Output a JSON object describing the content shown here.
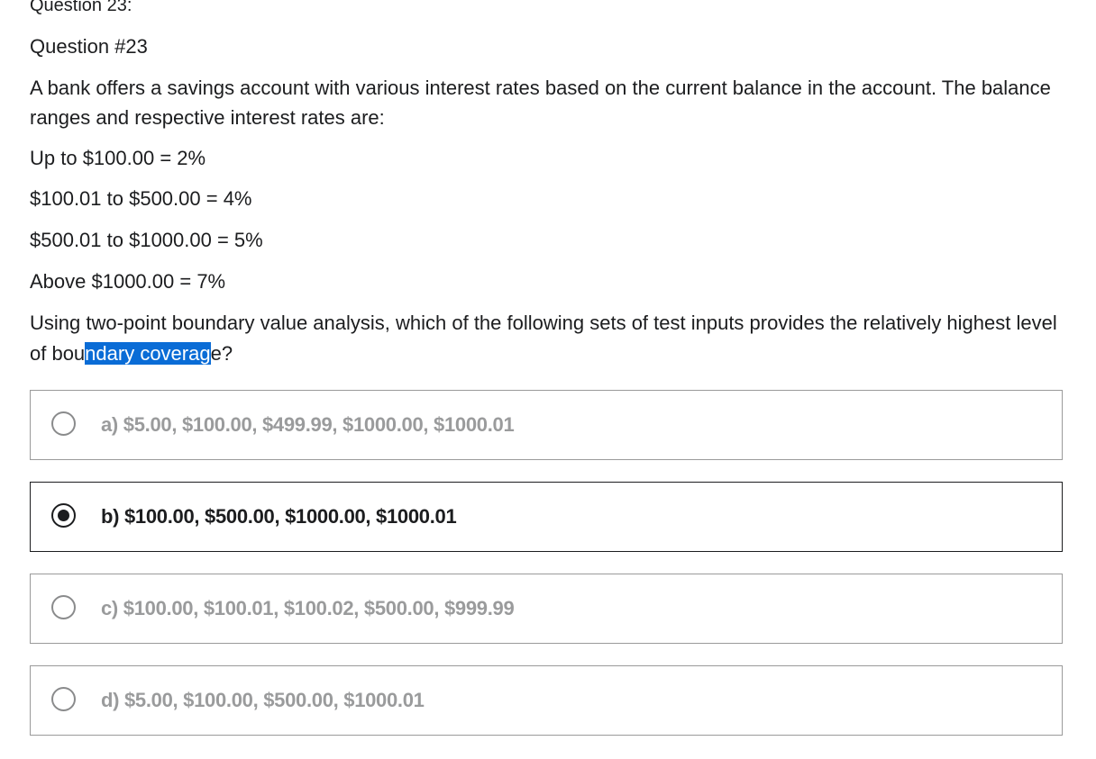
{
  "header": {
    "question_label": "Question 23:",
    "question_number": "Question #23"
  },
  "prompt": {
    "intro": "A bank offers a savings account with various interest rates based on the current balance in the account. The balance ranges and respective interest rates are:",
    "rates": [
      "Up to $100.00 = 2%",
      "$100.01 to $500.00 = 4%",
      "$500.01 to $1000.00 = 5%",
      "Above $1000.00 = 7%"
    ],
    "question_before": "Using two-point boundary value analysis, which of the following sets of test inputs provides the relatively highest level of bou",
    "question_highlight": "ndary coverag",
    "question_after": "e?"
  },
  "options": [
    {
      "label": "a) $5.00, $100.00, $499.99, $1000.00, $1000.01",
      "selected": false
    },
    {
      "label": "b) $100.00, $500.00, $1000.00, $1000.01",
      "selected": true
    },
    {
      "label": "c) $100.00, $100.01, $100.02, $500.00, $999.99",
      "selected": false
    },
    {
      "label": "d) $5.00, $100.00, $500.00, $1000.01",
      "selected": false
    }
  ]
}
